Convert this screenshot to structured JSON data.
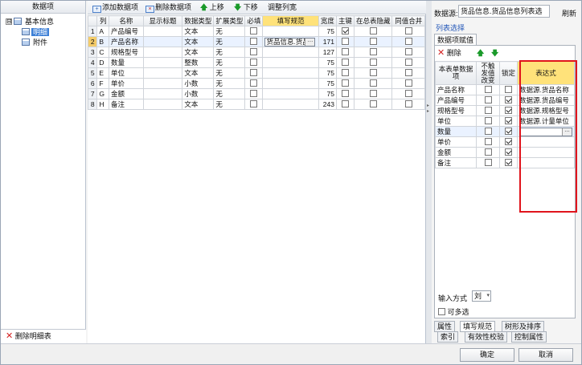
{
  "tree": {
    "header": "数据项",
    "root_toggle": "⊟",
    "root": "基本信息",
    "children": [
      "明细",
      "附件"
    ],
    "delete_detail": "删除明细表"
  },
  "toolbar": {
    "add": "添加数据项",
    "delete": "删除数据项",
    "up": "上移",
    "down": "下移",
    "adjust": "调整列宽"
  },
  "grid": {
    "headers": [
      "列",
      "名称",
      "显示标题",
      "数据类型",
      "扩展类型",
      "必填",
      "填写规范",
      "宽度",
      "主键",
      "在总表隐藏",
      "同值合并"
    ],
    "rows": [
      {
        "num": "1",
        "col": "A",
        "name": "产品编号",
        "title": "",
        "type": "文本",
        "ext": "无",
        "required": false,
        "rule": "",
        "width": "75",
        "pk": true,
        "hide": false,
        "merge": false
      },
      {
        "num": "2",
        "col": "B",
        "name": "产品名称",
        "title": "",
        "type": "文本",
        "ext": "无",
        "required": false,
        "rule": "货品信息.货品",
        "width": "171",
        "pk": false,
        "hide": false,
        "merge": false
      },
      {
        "num": "3",
        "col": "C",
        "name": "规格型号",
        "title": "",
        "type": "文本",
        "ext": "无",
        "required": false,
        "rule": "",
        "width": "127",
        "pk": false,
        "hide": false,
        "merge": false
      },
      {
        "num": "4",
        "col": "D",
        "name": "数量",
        "title": "",
        "type": "整数",
        "ext": "无",
        "required": false,
        "rule": "",
        "width": "75",
        "pk": false,
        "hide": false,
        "merge": false
      },
      {
        "num": "5",
        "col": "E",
        "name": "单位",
        "title": "",
        "type": "文本",
        "ext": "无",
        "required": false,
        "rule": "",
        "width": "75",
        "pk": false,
        "hide": false,
        "merge": false
      },
      {
        "num": "6",
        "col": "F",
        "name": "单价",
        "title": "",
        "type": "小数",
        "ext": "无",
        "required": false,
        "rule": "",
        "width": "75",
        "pk": false,
        "hide": false,
        "merge": false
      },
      {
        "num": "7",
        "col": "G",
        "name": "金额",
        "title": "",
        "type": "小数",
        "ext": "无",
        "required": false,
        "rule": "",
        "width": "75",
        "pk": false,
        "hide": false,
        "merge": false
      },
      {
        "num": "8",
        "col": "H",
        "name": "备注",
        "title": "",
        "type": "文本",
        "ext": "无",
        "required": false,
        "rule": "",
        "width": "243",
        "pk": false,
        "hide": false,
        "merge": false
      }
    ]
  },
  "right": {
    "source_label": "数据源:",
    "source_value": "货品信息.货品信息列表选",
    "refresh": "刷新",
    "column_select": "列表选择",
    "sub_tab": "数据项赋值",
    "delete": "删除",
    "headers": [
      "本表单数据项",
      "不触发值改变",
      "锁定",
      "表达式"
    ],
    "rows": [
      {
        "name": "产品名称",
        "no_trigger": false,
        "lock": false,
        "expr": "数据源.货品名称"
      },
      {
        "name": "产品编号",
        "no_trigger": false,
        "lock": true,
        "expr": "数据源.货品编号"
      },
      {
        "name": "规格型号",
        "no_trigger": false,
        "lock": true,
        "expr": "数据源.规格型号"
      },
      {
        "name": "单位",
        "no_trigger": false,
        "lock": true,
        "expr": "数据源.计量单位"
      },
      {
        "name": "数量",
        "no_trigger": false,
        "lock": true,
        "expr": ""
      },
      {
        "name": "单价",
        "no_trigger": false,
        "lock": true,
        "expr": ""
      },
      {
        "name": "金额",
        "no_trigger": false,
        "lock": true,
        "expr": ""
      },
      {
        "name": "备注",
        "no_trigger": false,
        "lock": true,
        "expr": ""
      }
    ],
    "input_mode_label": "输入方式",
    "input_mode_value": "刘",
    "multi_select": "可多选",
    "tabs_row1": [
      "属性",
      "填写规范",
      "树形及排序"
    ],
    "tabs_row2": [
      "索引",
      "有效性校验",
      "控制属性"
    ]
  },
  "dialog": {
    "ok": "确定",
    "cancel": "取消"
  },
  "colors": {
    "selected": "#3c7fd6",
    "highlight_header": "#ffe27a",
    "red_outline": "#e0141c",
    "arrow_green": "#1a9a2a",
    "delete_red": "#d42020"
  }
}
